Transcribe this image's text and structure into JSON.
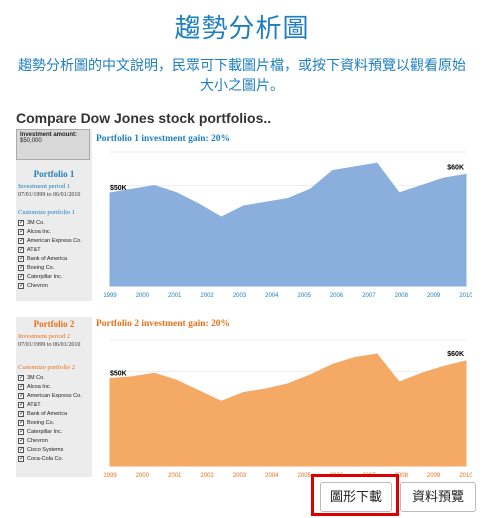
{
  "page": {
    "title": "趨勢分析圖",
    "description": "趨勢分析圖的中文說明，民眾可下載圖片檔，或按下資料預覽以觀看原始大小之圖片。"
  },
  "dashboard": {
    "title": "Compare Dow Jones stock portfolios..",
    "investment_label": "Investment amount:",
    "investment_value": "$50,000",
    "portfolio1": {
      "heading": "Portfolio 1",
      "period_label": "Investment period 1",
      "period_value": "07/01/1999 to 06/01/2010",
      "customize_label": "Customize portfolio 1",
      "companies": [
        "3M Co.",
        "Alcoa Inc.",
        "American Express Co.",
        "AT&T",
        "Bank of America",
        "Boeing Co.",
        "Caterpillar Inc.",
        "Chevron"
      ],
      "gain_title": "Portfolio 1 investment gain: 20%",
      "start_label": "$50K",
      "end_label": "$60K",
      "color": "#8aafdc"
    },
    "portfolio2": {
      "heading": "Portfolio 2",
      "period_label": "Investment period 2",
      "period_value": "07/01/1999 to 06/01/2010",
      "customize_label": "Customize portfolio 2",
      "companies": [
        "3M Co.",
        "Alcoa Inc.",
        "American Express Co.",
        "AT&T",
        "Bank of America",
        "Boeing Co.",
        "Caterpillar Inc.",
        "Chevron",
        "Cisco Systems",
        "Coca-Cola Co."
      ],
      "gain_title": "Portfolio 2 investment gain: 20%",
      "start_label": "$50K",
      "end_label": "$60K",
      "color": "#f4a965"
    }
  },
  "buttons": {
    "download_label": "圖形下載",
    "preview_label": "資料預覽"
  },
  "chart_data": [
    {
      "type": "area",
      "title": "Portfolio 1 investment gain: 20%",
      "x": [
        "1999",
        "2000",
        "2001",
        "2002",
        "2003",
        "2004",
        "2005",
        "2006",
        "2007",
        "2008",
        "2009",
        "2010"
      ],
      "series": [
        {
          "values": [
            50,
            52,
            54,
            50,
            44,
            37,
            43,
            45,
            47,
            52,
            62,
            64,
            66,
            50,
            54,
            58,
            60
          ]
        }
      ],
      "annotations": [
        "$50K",
        "$60K"
      ]
    },
    {
      "type": "area",
      "title": "Portfolio 2 investment gain: 20%",
      "x": [
        "1999",
        "2000",
        "2001",
        "2002",
        "2003",
        "2004",
        "2005",
        "2006",
        "2007",
        "2008",
        "2009",
        "2010"
      ],
      "series": [
        {
          "values": [
            50,
            51,
            53,
            49,
            43,
            37,
            42,
            44,
            47,
            52,
            58,
            62,
            64,
            48,
            53,
            57,
            60
          ]
        }
      ],
      "annotations": [
        "$50K",
        "$60K"
      ]
    }
  ]
}
